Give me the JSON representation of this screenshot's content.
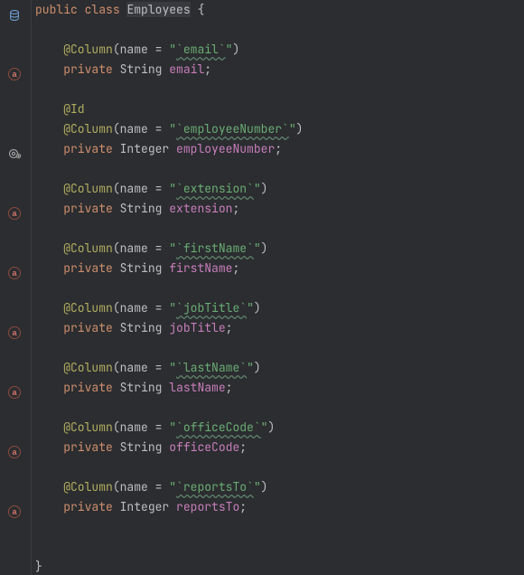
{
  "kw_public": "public",
  "kw_class": "class",
  "kw_private": "private",
  "class_name": "Employees",
  "brace_open": "{",
  "brace_close": "}",
  "ann_column": "@Column",
  "ann_id": "@Id",
  "attr_name": "name",
  "eq": " = ",
  "paren_open": "(",
  "paren_close": ")",
  "semi": ";",
  "quote": "\"",
  "type_string": "String",
  "type_integer": "Integer",
  "fields": [
    {
      "col": "`email`",
      "type": "String",
      "name": "email"
    },
    {
      "col": "`employeeNumber`",
      "type": "Integer",
      "name": "employeeNumber",
      "id": true
    },
    {
      "col": "`extension`",
      "type": "String",
      "name": "extension"
    },
    {
      "col": "`firstName`",
      "type": "String",
      "name": "firstName"
    },
    {
      "col": "`jobTitle`",
      "type": "String",
      "name": "jobTitle"
    },
    {
      "col": "`lastName`",
      "type": "String",
      "name": "lastName"
    },
    {
      "col": "`officeCode`",
      "type": "String",
      "name": "officeCode"
    },
    {
      "col": "`reportsTo`",
      "type": "Integer",
      "name": "reportsTo"
    }
  ],
  "gutter_positions": {
    "db": 9,
    "gear": 162,
    "a": [
      74,
      228,
      294,
      360,
      426,
      492,
      558
    ]
  }
}
